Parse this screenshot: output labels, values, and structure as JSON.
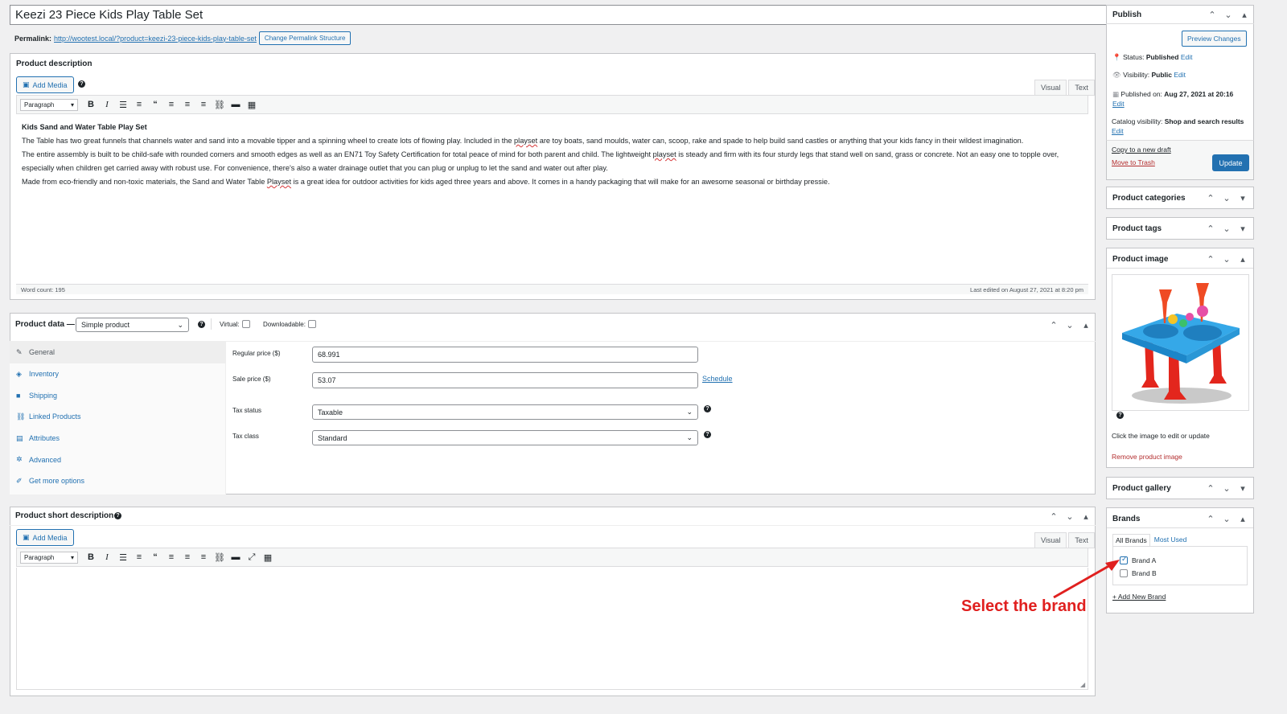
{
  "title": "Keezi 23 Piece Kids Play Table Set",
  "permalink": {
    "label": "Permalink:",
    "url": "http://wootest.local/?product=keezi-23-piece-kids-play-table-set",
    "button": "Change Permalink Structure"
  },
  "description_box": {
    "title": "Product description",
    "add_media": "Add Media",
    "tab_visual": "Visual",
    "tab_text": "Text",
    "format": "Paragraph",
    "heading": "Kids Sand and Water Table Play Set",
    "p1a": "The Table has two great funnels that channels water and sand into a movable tipper and a spinning wheel to create lots of flowing play. Included in the ",
    "p1_spell": "playset",
    "p1b": " are toy boats, sand moulds, water can, scoop, rake and spade to help build sand castles or anything that your kids fancy in their wildest imagination.",
    "p2a": "The entire assembly is built to be child-safe with rounded corners and smooth edges as well as an EN71 Toy Safety Certification for total peace of mind for both parent and child. The lightweight ",
    "p2_spell": "playset",
    "p2b": " is steady and firm with its four sturdy legs that stand well on sand, grass or concrete. Not an easy one to topple over, especially when children get carried away with robust use. For convenience, there's also a water drainage outlet that you can plug or unplug to let the sand and water out after play.",
    "p3a": "Made from eco-friendly and non-toxic materials, the Sand and Water Table ",
    "p3_spell": "Playset",
    "p3b": " is a great idea for outdoor activities for kids aged three years and above. It comes in a handy packaging that will make for an awesome seasonal or birthday pressie.",
    "word_count": "Word count: 195",
    "last_edited": "Last edited on August 27, 2021 at 8:20 pm"
  },
  "product_data": {
    "title": "Product data —",
    "type": "Simple product",
    "virtual_label": "Virtual:",
    "downloadable_label": "Downloadable:",
    "tabs": [
      {
        "label": "General",
        "icon": "wrench-icon"
      },
      {
        "label": "Inventory",
        "icon": "tag-icon"
      },
      {
        "label": "Shipping",
        "icon": "truck-icon"
      },
      {
        "label": "Linked Products",
        "icon": "link-icon"
      },
      {
        "label": "Attributes",
        "icon": "list-icon"
      },
      {
        "label": "Advanced",
        "icon": "gear-icon"
      },
      {
        "label": "Get more options",
        "icon": "plug-icon"
      }
    ],
    "regular_price_label": "Regular price ($)",
    "regular_price": "68.991",
    "sale_price_label": "Sale price ($)",
    "sale_price": "53.07",
    "schedule": "Schedule",
    "tax_status_label": "Tax status",
    "tax_status": "Taxable",
    "tax_class_label": "Tax class",
    "tax_class": "Standard"
  },
  "short_description": {
    "title": "Product short description",
    "add_media": "Add Media",
    "tab_visual": "Visual",
    "tab_text": "Text",
    "format": "Paragraph"
  },
  "publish": {
    "title": "Publish",
    "preview": "Preview Changes",
    "status_label": "Status:",
    "status_value": "Published",
    "visibility_label": "Visibility:",
    "visibility_value": "Public",
    "published_label": "Published on:",
    "published_value": "Aug 27, 2021 at 20:16",
    "catalog_label": "Catalog visibility:",
    "catalog_value": "Shop and search results",
    "edit": "Edit",
    "copy_draft": "Copy to a new draft",
    "trash": "Move to Trash",
    "update": "Update"
  },
  "sidebar_boxes": {
    "categories": "Product categories",
    "tags": "Product tags",
    "image": "Product image",
    "image_help": "Click the image to edit or update",
    "remove_image": "Remove product image",
    "gallery": "Product gallery"
  },
  "brands": {
    "title": "Brands",
    "tab_all": "All Brands",
    "tab_most_used": "Most Used",
    "items": [
      {
        "label": "Brand A",
        "checked": true
      },
      {
        "label": "Brand B",
        "checked": false
      }
    ],
    "add_new": "+ Add New Brand"
  },
  "annotation": "Select the brand",
  "colors": {
    "accent": "#2271b1",
    "danger": "#d63638",
    "annotation": "#e0201f"
  }
}
